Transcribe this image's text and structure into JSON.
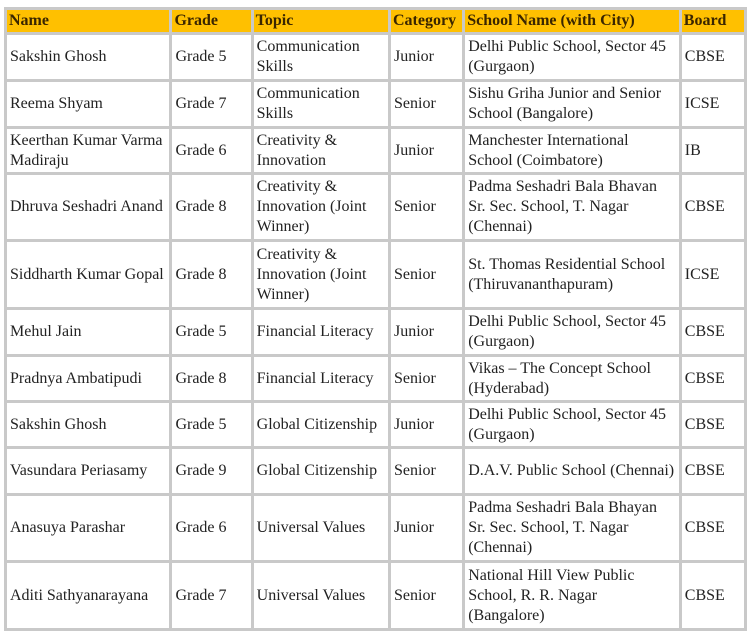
{
  "table": {
    "headers": [
      "Name",
      "Grade",
      "Topic",
      "Category",
      "School Name (with City)",
      "Board"
    ],
    "header_bg": "#ffc000",
    "rows": [
      [
        "Sakshin Ghosh",
        "Grade 5",
        "Communication Skills",
        "Junior",
        "Delhi Public School, Sector 45 (Gurgaon)",
        "CBSE"
      ],
      [
        "Reema Shyam",
        "Grade 7",
        "Communication Skills",
        "Senior",
        "Sishu Griha Junior and Senior School (Bangalore)",
        "ICSE"
      ],
      [
        "Keerthan Kumar Varma Madiraju",
        "Grade 6",
        "Creativity & Innovation",
        "Junior",
        "Manchester International School (Coimbatore)",
        "IB"
      ],
      [
        "Dhruva Seshadri Anand",
        "Grade 8",
        "Creativity & Innovation (Joint Winner)",
        "Senior",
        "Padma Seshadri Bala Bhavan Sr. Sec. School, T. Nagar (Chennai)",
        "CBSE"
      ],
      [
        "Siddharth Kumar Gopal",
        "Grade 8",
        "Creativity & Innovation (Joint Winner)",
        "Senior",
        "St. Thomas Residential School (Thiruvananthapuram)",
        "ICSE"
      ],
      [
        "Mehul Jain",
        "Grade 5",
        "Financial Literacy",
        "Junior",
        "Delhi Public School, Sector 45 (Gurgaon)",
        "CBSE"
      ],
      [
        "Pradnya Ambatipudi",
        "Grade 8",
        "Financial Literacy",
        "Senior",
        "Vikas – The Concept School (Hyderabad)",
        "CBSE"
      ],
      [
        "Sakshin Ghosh",
        "Grade 5",
        "Global Citizenship",
        "Junior",
        "Delhi Public School, Sector 45 (Gurgaon)",
        "CBSE"
      ],
      [
        "Vasundara Periasamy",
        "Grade 9",
        "Global Citizenship",
        "Senior",
        "D.A.V. Public School (Chennai)",
        "CBSE"
      ],
      [
        "Anasuya Parashar",
        "Grade 6",
        "Universal Values",
        "Junior",
        "Padma Seshadri Bala Bhayan Sr. Sec. School, T. Nagar (Chennai)",
        "CBSE"
      ],
      [
        "Aditi Sathyanarayana",
        "Grade 7",
        "Universal Values",
        "Senior",
        "National Hill View Public School, R. R. Nagar (Bangalore)",
        "CBSE"
      ]
    ]
  }
}
